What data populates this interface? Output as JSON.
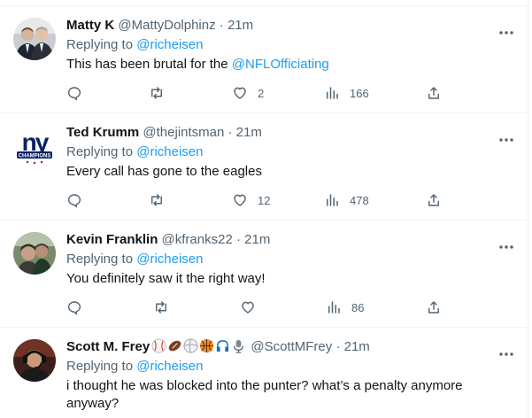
{
  "colors": {
    "link": "#1d9bf0",
    "muted": "#536471",
    "text": "#0f1419",
    "divider": "#eff3f4"
  },
  "tweets": [
    {
      "name": "Matty K",
      "handle": "@MattyDolphinz",
      "time": "· 21m",
      "replying_label": "Replying to",
      "replying_to": "@richeisen",
      "text_before": "This has been brutal for the ",
      "text_mention": "@NFLOfficiating",
      "likes": "2",
      "views": "166",
      "avatar_icon": "two-men-photo-avatar"
    },
    {
      "name": "Ted Krumm",
      "handle": "@thejintsman",
      "time": "· 21m",
      "replying_label": "Replying to",
      "replying_to": "@richeisen",
      "text": "Every call has gone to the eagles",
      "likes": "12",
      "views": "478",
      "avatar_icon": "ny-giants-logo-avatar",
      "avatar_logo_text": "ny",
      "avatar_banner_text": "CHAMPIONS"
    },
    {
      "name": "Kevin Franklin",
      "handle": "@kfranks22",
      "time": "· 21m",
      "replying_label": "Replying to",
      "replying_to": "@richeisen",
      "text": "You definitely saw it the right way!",
      "likes": "",
      "views": "86",
      "avatar_icon": "stadium-selfie-avatar"
    },
    {
      "name": "Scott M. Frey",
      "name_emojis": [
        "baseball-icon",
        "football-icon",
        "volleyball-icon",
        "basketball-icon",
        "headphones-icon",
        "microphone-icon"
      ],
      "handle": "@ScottMFrey",
      "time": "· 21m",
      "replying_label": "Replying to",
      "replying_to": "@richeisen",
      "text": "i thought he was blocked into the punter? what’s a penalty anymore anyway?",
      "avatar_icon": "headset-man-avatar"
    }
  ]
}
